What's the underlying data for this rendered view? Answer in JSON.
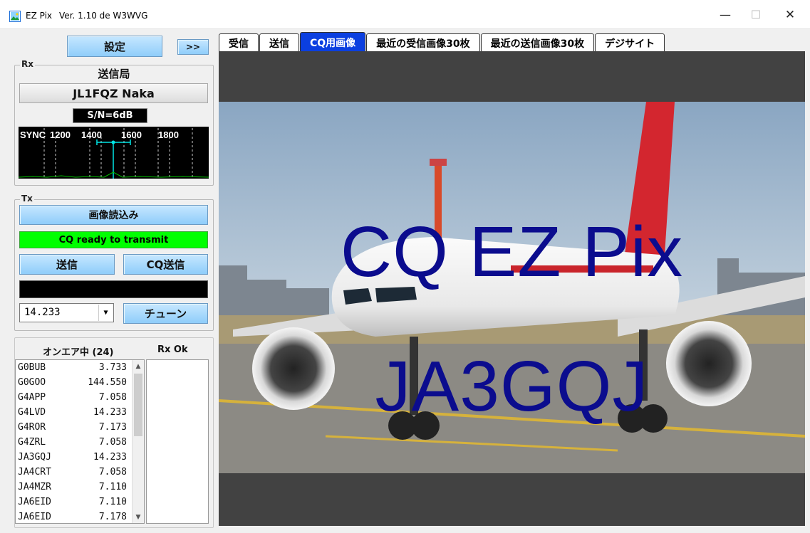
{
  "window": {
    "app_name": "EZ Pix",
    "version": "Ver. 1.10 de W3WVG",
    "minimize": "—",
    "maximize": "☐",
    "close": "✕"
  },
  "left": {
    "settings_label": "設定",
    "expand_label": ">>",
    "rx": {
      "label": "Rx",
      "station_title": "送信局",
      "callsign": "JL1FQZ Naka",
      "snr": "S/N=6dB",
      "waterfall_labels": [
        "SYNC",
        "1200",
        "1400",
        "1600",
        "1800"
      ]
    },
    "tx": {
      "label": "Tx",
      "load_image_label": "画像読込み",
      "status": "CQ ready to transmit",
      "send_label": "送信",
      "cq_send_label": "CQ送信",
      "frequency": "14.233",
      "tune_label": "チューン"
    },
    "onair": {
      "title": "オンエア中 (24)",
      "rxok_title": "Rx Ok",
      "rows": [
        {
          "call": "G0BUB",
          "freq": "3.733"
        },
        {
          "call": "G0GOO",
          "freq": "144.550"
        },
        {
          "call": "G4APP",
          "freq": "7.058"
        },
        {
          "call": "G4LVD",
          "freq": "14.233"
        },
        {
          "call": "G4ROR",
          "freq": "7.173"
        },
        {
          "call": "G4ZRL",
          "freq": "7.058"
        },
        {
          "call": "JA3GQJ",
          "freq": "14.233"
        },
        {
          "call": "JA4CRT",
          "freq": "7.058"
        },
        {
          "call": "JA4MZR",
          "freq": "7.110"
        },
        {
          "call": "JA6EID",
          "freq": "7.110"
        },
        {
          "call": "JA6EID",
          "freq": "7.178"
        }
      ]
    }
  },
  "tabs": [
    {
      "label": "受信",
      "active": false
    },
    {
      "label": "送信",
      "active": false
    },
    {
      "label": "CQ用画像",
      "active": true
    },
    {
      "label": "最近の受信画像30枚",
      "active": false
    },
    {
      "label": "最近の送信画像30枚",
      "active": false
    },
    {
      "label": "デジサイト",
      "active": false
    }
  ],
  "image": {
    "line1": "CQ EZ Pix",
    "line2": "JA3GQJ",
    "text_color": "#0b0c8e"
  },
  "colors": {
    "status_green": "#00ff00",
    "active_tab": "#0b3fe0",
    "button_blue": "#8fcdfa"
  }
}
